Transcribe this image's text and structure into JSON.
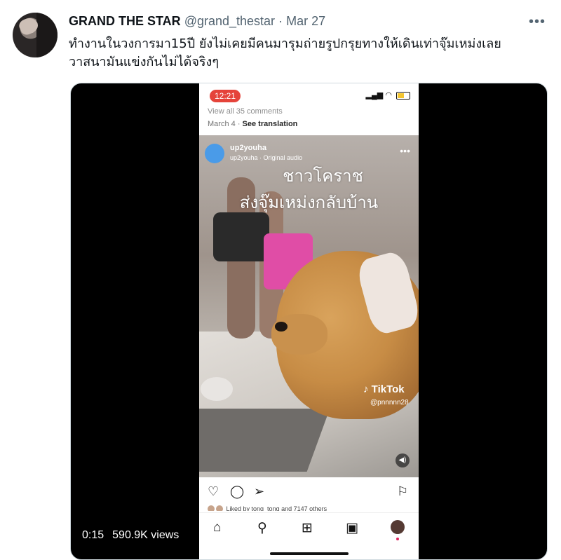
{
  "tweet": {
    "author_name": "GRAND THE STAR",
    "handle": "@grand_thestar",
    "separator": "·",
    "date": "Mar 27",
    "more_icon": "more-icon",
    "text_line1": "ทำงานในวงการมา15ปี ยังไม่เคยมีคนมารุมถ่ายรูปกรุยทางให้เดินเท่าจุ๊มเหม่งเลย",
    "text_line2": "วาสนามันแข่งกันไม่ได้จริงๆ"
  },
  "video": {
    "duration": "0:15",
    "views": "590.9K views"
  },
  "phone": {
    "status_time": "12:21",
    "comments_text": "View all 35 comments",
    "post_date": "March 4",
    "date_sep": "·",
    "see_translation": "See translation",
    "reel_username": "up2youha",
    "reel_subtitle": "up2youha · Original audio",
    "overlay_line1": "ชาวโคราช",
    "overlay_line2": "ส่งจุ๊มเหม่งกลับบ้าน",
    "tiktok_label": "TikTok",
    "tiktok_user": "@pnnnnn28",
    "liked_text": "Liked by tong_tong and 7147 others",
    "accent_color": "#e5433a",
    "nav_icons": [
      "home-icon",
      "search-icon",
      "add-post-icon",
      "reels-icon",
      "profile-avatar"
    ]
  }
}
